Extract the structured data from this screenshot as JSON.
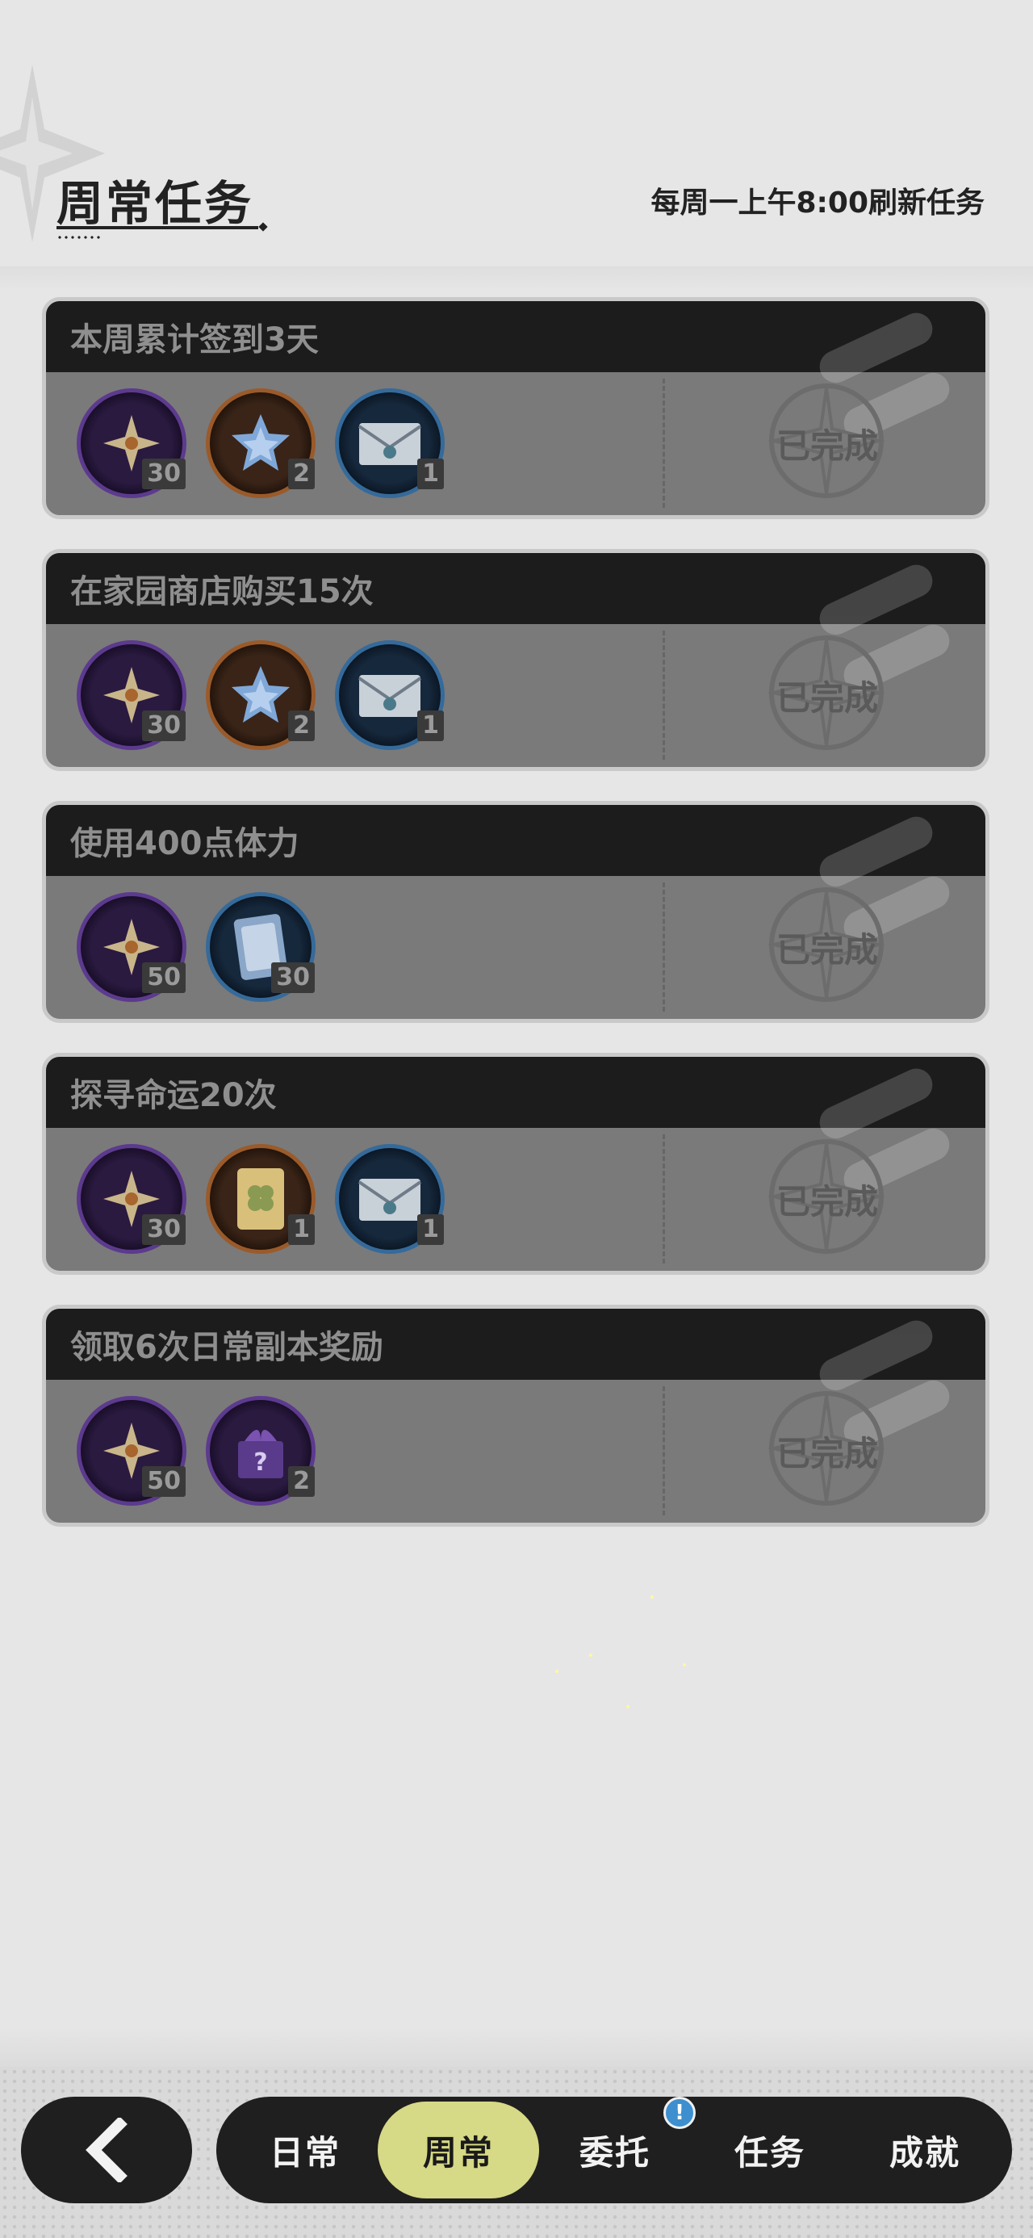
{
  "header": {
    "title": "周常任务",
    "refresh_note": "每周一上午8:00刷新任务"
  },
  "quests": [
    {
      "title": "本周累计签到3天",
      "status": "已完成",
      "rewards": [
        {
          "icon": "star-shard-icon",
          "count": "30",
          "rarity": "purple"
        },
        {
          "icon": "crystal-icon",
          "count": "2",
          "rarity": "orange"
        },
        {
          "icon": "letter-icon",
          "count": "1",
          "rarity": "blue"
        }
      ]
    },
    {
      "title": "在家园商店购买15次",
      "status": "已完成",
      "rewards": [
        {
          "icon": "star-shard-icon",
          "count": "30",
          "rarity": "purple"
        },
        {
          "icon": "crystal-icon",
          "count": "2",
          "rarity": "orange"
        },
        {
          "icon": "letter-icon",
          "count": "1",
          "rarity": "blue"
        }
      ]
    },
    {
      "title": "使用400点体力",
      "status": "已完成",
      "rewards": [
        {
          "icon": "star-shard-icon",
          "count": "50",
          "rarity": "purple"
        },
        {
          "icon": "card-icon",
          "count": "30",
          "rarity": "blue"
        }
      ]
    },
    {
      "title": "探寻命运20次",
      "status": "已完成",
      "rewards": [
        {
          "icon": "star-shard-icon",
          "count": "30",
          "rarity": "purple"
        },
        {
          "icon": "clover-card-icon",
          "count": "1",
          "rarity": "orange"
        },
        {
          "icon": "letter-icon",
          "count": "1",
          "rarity": "blue"
        }
      ]
    },
    {
      "title": "领取6次日常副本奖励",
      "status": "已完成",
      "rewards": [
        {
          "icon": "star-shard-icon",
          "count": "50",
          "rarity": "purple"
        },
        {
          "icon": "mystery-box-icon",
          "count": "2",
          "rarity": "purple"
        }
      ]
    }
  ],
  "nav": {
    "tabs": [
      {
        "label": "日常",
        "active": false
      },
      {
        "label": "周常",
        "active": true
      },
      {
        "label": "委托",
        "active": false
      },
      {
        "label": "任务",
        "active": false
      },
      {
        "label": "成就",
        "active": false
      }
    ],
    "badge": "!"
  },
  "colors": {
    "active_tab": "#d6d985",
    "nav_bg": "#1f1f1f",
    "badge": "#3d8fcf"
  }
}
